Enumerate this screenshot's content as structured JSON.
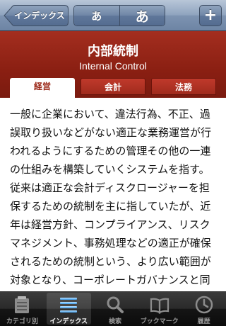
{
  "navbar": {
    "back_label": "インデックス",
    "segment": [
      "あ",
      "あ"
    ],
    "add_label": "+"
  },
  "header": {
    "title_ja": "内部統制",
    "title_en": "Internal Control",
    "tabs": [
      {
        "label": "経営",
        "active": true
      },
      {
        "label": "会計",
        "active": false
      },
      {
        "label": "法務",
        "active": false
      }
    ]
  },
  "content": {
    "text": "一般に企業において、違法行為、不正、過誤取り扱いなどがない適正な業務運営が行われるようにするための管理その他の一連の仕組みを構築していくシステムを指す。従来は適正な会計ディスクロージャーを担保するための統制を主に指していたが、近年は経営方針、コンプライアンス、リスクマネジメント、事務処理などの適正が確保されるための統制という、より広い範囲が対象となり、コーポレートガバナンスと同義に使用される"
  },
  "tabbar": {
    "items": [
      {
        "label": "カテゴリ別",
        "icon": "category-icon",
        "selected": false
      },
      {
        "label": "インデックス",
        "icon": "index-list-icon",
        "selected": true
      },
      {
        "label": "検索",
        "icon": "search-icon",
        "selected": false
      },
      {
        "label": "ブックマーク",
        "icon": "bookmark-book-icon",
        "selected": false
      },
      {
        "label": "履歴",
        "icon": "history-clock-icon",
        "selected": false
      }
    ]
  },
  "colors": {
    "nav_blue": "#7d93b1",
    "header_red": "#8a1f12",
    "active_tab_text": "#9c2a1a"
  }
}
